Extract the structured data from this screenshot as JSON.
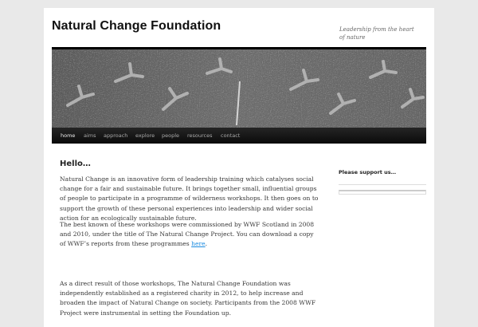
{
  "site": {
    "title": "Natural Change Foundation",
    "tagline": "Leadership from the heart of nature"
  },
  "header_image": {
    "description_icon": "snow-bird-tracks-image"
  },
  "nav": {
    "items": [
      {
        "label": "home",
        "current": true
      },
      {
        "label": "aims"
      },
      {
        "label": "approach"
      },
      {
        "label": "explore"
      },
      {
        "label": "people"
      },
      {
        "label": "resources"
      },
      {
        "label": "contact"
      }
    ]
  },
  "entry": {
    "title": "Hello…",
    "p1": "Natural Change is an innovative form of leadership training which catalyses social change for a fair and sustainable future. It brings together small, influential groups of people to participate in a programme of wilderness workshops.  It then goes on to support the growth of these personal experiences into leadership and wider social action for an ecologically sustainable future.",
    "p2_before": "The best known of these workshops were commissioned by WWF Scotland  in 2008 and 2010, under the title of The Natural Change Project. You can download a copy of WWF’s reports from these programmes ",
    "p2_link": "here",
    "p2_after": ".",
    "p3": "As a direct result of those workshops, The Natural Change Foundation was independently established as a registered charity in 2012,  to help increase and broaden the impact of Natural Change on society. Participants from the 2008 WWF Project were instrumental in setting the Foundation up."
  },
  "sidebar": {
    "widget_title": "Please support us…"
  },
  "colors": {
    "background": "#e9e9e9",
    "page": "#ffffff",
    "nav_bar": "#111111",
    "link": "#1b8be0",
    "text": "#373737"
  }
}
